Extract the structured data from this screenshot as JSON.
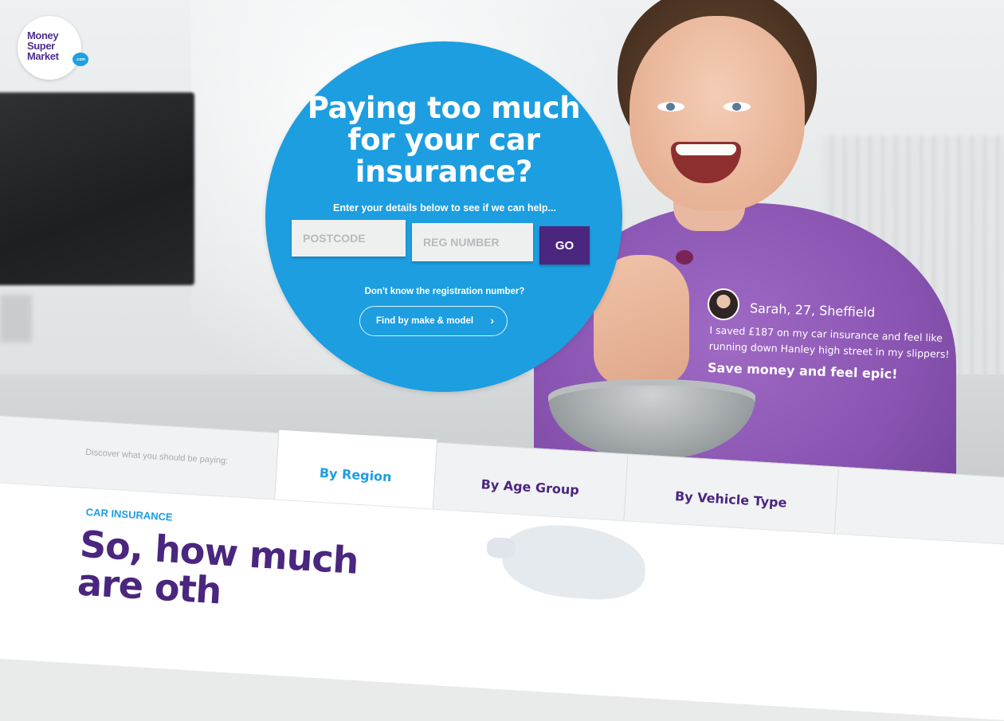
{
  "logo": {
    "text": "Money Super Market",
    "badge": ".com"
  },
  "hero": {
    "title": "Paying too much for your car insurance?",
    "subtitle": "Enter your details below to see if we can help...",
    "postcode_placeholder": "POSTCODE",
    "reg_placeholder": "REG NUMBER",
    "go_label": "GO",
    "reg_question": "Don't know the registration number?",
    "find_label": "Find by make & model",
    "accent_color": "#1c9ee0",
    "button_color": "#4a267f"
  },
  "testimonial": {
    "name": "Sarah, 27, Sheffield",
    "quote": "I saved £187 on my car insurance and feel like running down Hanley high street in my slippers!",
    "tagline": "Save money and feel epic!"
  },
  "tabs": {
    "intro": "Discover what you should be paying:",
    "items": [
      {
        "label": "By Region",
        "active": true
      },
      {
        "label": "By Age Group",
        "active": false
      },
      {
        "label": "By Vehicle Type",
        "active": false
      },
      {
        "label": "",
        "active": false
      }
    ]
  },
  "content": {
    "eyebrow": "CAR INSURANCE",
    "headline": "So, how much are oth"
  }
}
